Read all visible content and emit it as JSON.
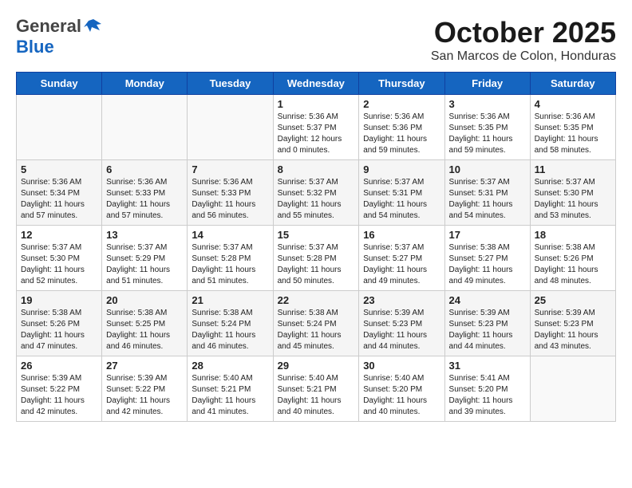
{
  "header": {
    "logo_general": "General",
    "logo_blue": "Blue",
    "month": "October 2025",
    "location": "San Marcos de Colon, Honduras"
  },
  "weekdays": [
    "Sunday",
    "Monday",
    "Tuesday",
    "Wednesday",
    "Thursday",
    "Friday",
    "Saturday"
  ],
  "weeks": [
    [
      {
        "day": "",
        "info": ""
      },
      {
        "day": "",
        "info": ""
      },
      {
        "day": "",
        "info": ""
      },
      {
        "day": "1",
        "info": "Sunrise: 5:36 AM\nSunset: 5:37 PM\nDaylight: 12 hours\nand 0 minutes."
      },
      {
        "day": "2",
        "info": "Sunrise: 5:36 AM\nSunset: 5:36 PM\nDaylight: 11 hours\nand 59 minutes."
      },
      {
        "day": "3",
        "info": "Sunrise: 5:36 AM\nSunset: 5:35 PM\nDaylight: 11 hours\nand 59 minutes."
      },
      {
        "day": "4",
        "info": "Sunrise: 5:36 AM\nSunset: 5:35 PM\nDaylight: 11 hours\nand 58 minutes."
      }
    ],
    [
      {
        "day": "5",
        "info": "Sunrise: 5:36 AM\nSunset: 5:34 PM\nDaylight: 11 hours\nand 57 minutes."
      },
      {
        "day": "6",
        "info": "Sunrise: 5:36 AM\nSunset: 5:33 PM\nDaylight: 11 hours\nand 57 minutes."
      },
      {
        "day": "7",
        "info": "Sunrise: 5:36 AM\nSunset: 5:33 PM\nDaylight: 11 hours\nand 56 minutes."
      },
      {
        "day": "8",
        "info": "Sunrise: 5:37 AM\nSunset: 5:32 PM\nDaylight: 11 hours\nand 55 minutes."
      },
      {
        "day": "9",
        "info": "Sunrise: 5:37 AM\nSunset: 5:31 PM\nDaylight: 11 hours\nand 54 minutes."
      },
      {
        "day": "10",
        "info": "Sunrise: 5:37 AM\nSunset: 5:31 PM\nDaylight: 11 hours\nand 54 minutes."
      },
      {
        "day": "11",
        "info": "Sunrise: 5:37 AM\nSunset: 5:30 PM\nDaylight: 11 hours\nand 53 minutes."
      }
    ],
    [
      {
        "day": "12",
        "info": "Sunrise: 5:37 AM\nSunset: 5:30 PM\nDaylight: 11 hours\nand 52 minutes."
      },
      {
        "day": "13",
        "info": "Sunrise: 5:37 AM\nSunset: 5:29 PM\nDaylight: 11 hours\nand 51 minutes."
      },
      {
        "day": "14",
        "info": "Sunrise: 5:37 AM\nSunset: 5:28 PM\nDaylight: 11 hours\nand 51 minutes."
      },
      {
        "day": "15",
        "info": "Sunrise: 5:37 AM\nSunset: 5:28 PM\nDaylight: 11 hours\nand 50 minutes."
      },
      {
        "day": "16",
        "info": "Sunrise: 5:37 AM\nSunset: 5:27 PM\nDaylight: 11 hours\nand 49 minutes."
      },
      {
        "day": "17",
        "info": "Sunrise: 5:38 AM\nSunset: 5:27 PM\nDaylight: 11 hours\nand 49 minutes."
      },
      {
        "day": "18",
        "info": "Sunrise: 5:38 AM\nSunset: 5:26 PM\nDaylight: 11 hours\nand 48 minutes."
      }
    ],
    [
      {
        "day": "19",
        "info": "Sunrise: 5:38 AM\nSunset: 5:26 PM\nDaylight: 11 hours\nand 47 minutes."
      },
      {
        "day": "20",
        "info": "Sunrise: 5:38 AM\nSunset: 5:25 PM\nDaylight: 11 hours\nand 46 minutes."
      },
      {
        "day": "21",
        "info": "Sunrise: 5:38 AM\nSunset: 5:24 PM\nDaylight: 11 hours\nand 46 minutes."
      },
      {
        "day": "22",
        "info": "Sunrise: 5:38 AM\nSunset: 5:24 PM\nDaylight: 11 hours\nand 45 minutes."
      },
      {
        "day": "23",
        "info": "Sunrise: 5:39 AM\nSunset: 5:23 PM\nDaylight: 11 hours\nand 44 minutes."
      },
      {
        "day": "24",
        "info": "Sunrise: 5:39 AM\nSunset: 5:23 PM\nDaylight: 11 hours\nand 44 minutes."
      },
      {
        "day": "25",
        "info": "Sunrise: 5:39 AM\nSunset: 5:23 PM\nDaylight: 11 hours\nand 43 minutes."
      }
    ],
    [
      {
        "day": "26",
        "info": "Sunrise: 5:39 AM\nSunset: 5:22 PM\nDaylight: 11 hours\nand 42 minutes."
      },
      {
        "day": "27",
        "info": "Sunrise: 5:39 AM\nSunset: 5:22 PM\nDaylight: 11 hours\nand 42 minutes."
      },
      {
        "day": "28",
        "info": "Sunrise: 5:40 AM\nSunset: 5:21 PM\nDaylight: 11 hours\nand 41 minutes."
      },
      {
        "day": "29",
        "info": "Sunrise: 5:40 AM\nSunset: 5:21 PM\nDaylight: 11 hours\nand 40 minutes."
      },
      {
        "day": "30",
        "info": "Sunrise: 5:40 AM\nSunset: 5:20 PM\nDaylight: 11 hours\nand 40 minutes."
      },
      {
        "day": "31",
        "info": "Sunrise: 5:41 AM\nSunset: 5:20 PM\nDaylight: 11 hours\nand 39 minutes."
      },
      {
        "day": "",
        "info": ""
      }
    ]
  ]
}
